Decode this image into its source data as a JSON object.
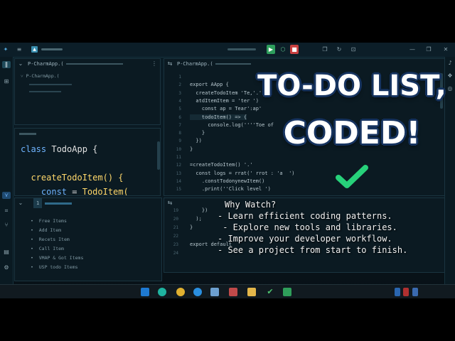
{
  "window": {
    "titlebar_icons": [
      "app-logo-icon",
      "menu-icon",
      "project-icon"
    ],
    "top_buttons": [
      "run-button-icon",
      "debug-icon",
      "stop-button-icon"
    ],
    "window_controls": [
      "copy-icon",
      "refresh-icon",
      "split-icon",
      "minimize-icon",
      "maximize-icon",
      "close-icon"
    ]
  },
  "explorer": {
    "tab_label": "P-CharmApp.(",
    "tree_item": "P-CharmApp.("
  },
  "left_code": {
    "lines": [
      {
        "parts": [
          {
            "t": "class ",
            "c": "kw"
          },
          {
            "t": "TodoApp {",
            "c": "cls"
          }
        ]
      },
      {
        "parts": [
          {
            "t": "",
            "c": "cls"
          }
        ]
      },
      {
        "parts": [
          {
            "t": "  createTodoItem() {",
            "c": "fn"
          }
        ]
      },
      {
        "parts": [
          {
            "t": "    const ",
            "c": "kw"
          },
          {
            "t": "= ",
            "c": "cls"
          },
          {
            "t": "TodoItem(",
            "c": "fn"
          }
        ]
      }
    ]
  },
  "editor": {
    "tab_label": "P-CharmApp.(",
    "lines": [
      {
        "n": "1",
        "t": ""
      },
      {
        "n": "2",
        "t": "export AApp {"
      },
      {
        "n": "3",
        "t": "  createTodoItem 'Te,'.'"
      },
      {
        "n": "4",
        "t": "  atdItemItem = 'ter ')"
      },
      {
        "n": "5",
        "t": "    const ap = Tear':ap'"
      },
      {
        "n": "6",
        "t": "    todoItem() => {"
      },
      {
        "n": "7",
        "t": "      console.log(''''Toe of"
      },
      {
        "n": "8",
        "t": "    }"
      },
      {
        "n": "9",
        "t": "  })"
      },
      {
        "n": "10",
        "t": "}"
      },
      {
        "n": "11",
        "t": ""
      },
      {
        "n": "12",
        "t": "=createTodoItem() '.'"
      },
      {
        "n": "13",
        "t": "  const logs = rrat(' rrot : 'a  ')"
      },
      {
        "n": "14",
        "t": "    .constTodonynewItem()"
      },
      {
        "n": "15",
        "t": "    .print(''Click level ')"
      }
    ]
  },
  "bottom_panel": {
    "tab_label": "1",
    "outline": [
      "Free Items",
      "Add Item",
      "Recets Item",
      "Call Item",
      "VMAP & Got Items",
      "USP todo Items"
    ]
  },
  "bottom_editor": {
    "lines": [
      {
        "n": "19",
        "t": "    })"
      },
      {
        "n": "20",
        "t": "  );"
      },
      {
        "n": "21",
        "t": "}"
      },
      {
        "n": "22",
        "t": ""
      },
      {
        "n": "23",
        "t": "export default"
      },
      {
        "n": "24",
        "t": ""
      }
    ]
  },
  "overlay": {
    "headline_line1": "TO-DO LIST,",
    "headline_line2": "CODED!",
    "why_title": "Why Watch?",
    "why_items": [
      "- Learn efficient coding patterns.",
      " - Explore new tools and libraries.",
      "- Improve your developer workflow.",
      "- See a project from start to finish."
    ],
    "check_color": "#27d17a"
  },
  "taskbar": {
    "icons": [
      "vscode-icon",
      "edge-icon",
      "chrome-icon",
      "todo-icon",
      "files-icon",
      "tools-icon",
      "folder-icon",
      "check-icon",
      "todo-app-icon"
    ]
  }
}
